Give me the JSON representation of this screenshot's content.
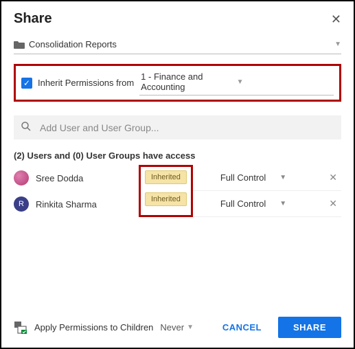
{
  "header": {
    "title": "Share"
  },
  "folder": {
    "name": "Consolidation Reports"
  },
  "inherit": {
    "checked": true,
    "prefix": "Inherit Permissions from",
    "source": "1 - Finance and Accounting"
  },
  "search": {
    "placeholder": "Add User and User Group..."
  },
  "access_summary": "(2) Users and (0) User Groups have access",
  "users": [
    {
      "name": "Sree Dodda",
      "avatar_type": "image",
      "initial": "",
      "badge": "Inherited",
      "role": "Full Control"
    },
    {
      "name": "Rinkita Sharma",
      "avatar_type": "letter",
      "initial": "R",
      "badge": "Inherited",
      "role": "Full Control"
    }
  ],
  "footer": {
    "apply_label": "Apply Permissions to Children",
    "frequency": "Never",
    "cancel": "CANCEL",
    "share": "SHARE"
  }
}
